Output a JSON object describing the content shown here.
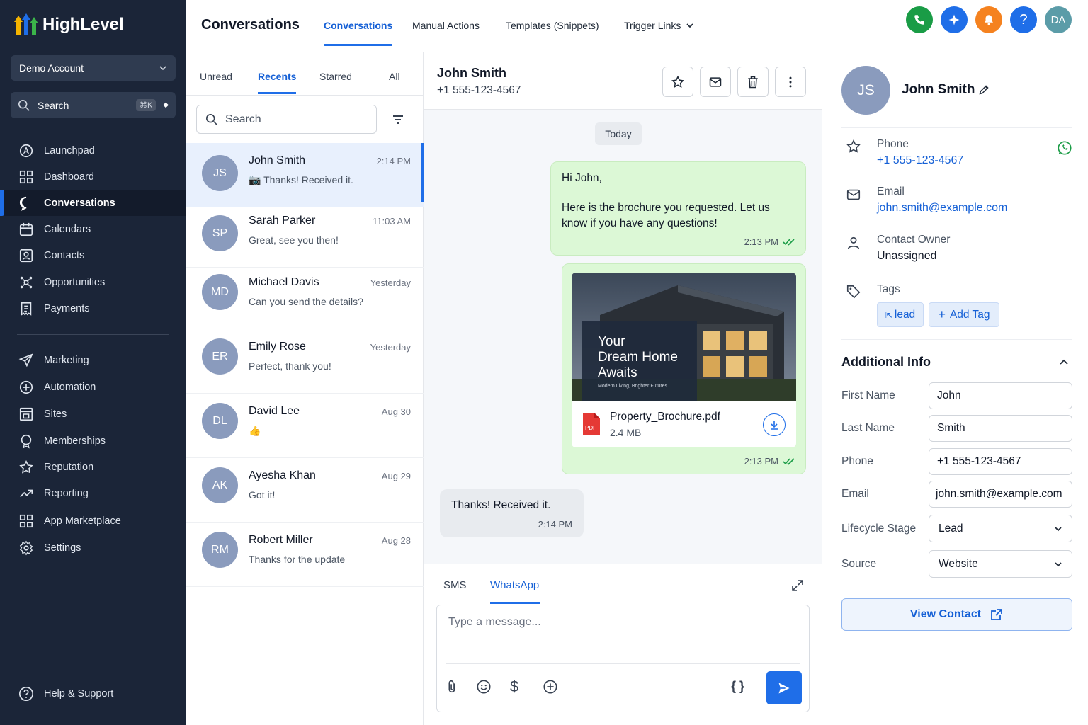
{
  "app": {
    "logo_text": "HighLevel",
    "account": "Demo Account",
    "search_label": "Search",
    "search_shortcut": "⌘K"
  },
  "sidebar": {
    "items": [
      {
        "label": "Launchpad",
        "icon": "rocket-icon"
      },
      {
        "label": "Dashboard",
        "icon": "grid-icon"
      },
      {
        "label": "Conversations",
        "icon": "chat-icon",
        "active": true
      },
      {
        "label": "Calendars",
        "icon": "calendar-icon"
      },
      {
        "label": "Contacts",
        "icon": "contact-card-icon"
      },
      {
        "label": "Opportunities",
        "icon": "network-icon"
      },
      {
        "label": "Payments",
        "icon": "receipt-icon"
      }
    ],
    "items2": [
      {
        "label": "Marketing",
        "icon": "send-icon"
      },
      {
        "label": "Automation",
        "icon": "automation-icon"
      },
      {
        "label": "Sites",
        "icon": "sites-icon"
      },
      {
        "label": "Memberships",
        "icon": "award-icon"
      },
      {
        "label": "Reputation",
        "icon": "star-icon"
      },
      {
        "label": "Reporting",
        "icon": "trend-icon"
      },
      {
        "label": "App Marketplace",
        "icon": "apps-icon"
      },
      {
        "label": "Settings",
        "icon": "gear-icon"
      }
    ],
    "help": "Help & Support"
  },
  "topbar": {
    "title": "Conversations",
    "tabs": [
      "Conversations",
      "Manual Actions",
      "Templates (Snippets)",
      "Trigger Links"
    ],
    "user_initials": "DA",
    "colors": {
      "phone": "#1a9c46",
      "ai": "#1f6ee8",
      "bell": "#f5821f",
      "help": "#1f6ee8",
      "user": "#5b9ca8"
    }
  },
  "list": {
    "filters": [
      "Unread",
      "Recents",
      "Starred",
      "All"
    ],
    "search_placeholder": "Search",
    "conversations": [
      {
        "initials": "JS",
        "name": "John Smith",
        "time": "2:14 PM",
        "preview": "📷 Thanks! Received it."
      },
      {
        "initials": "SP",
        "name": "Sarah Parker",
        "time": "11:03 AM",
        "preview": "Great, see you then!"
      },
      {
        "initials": "MD",
        "name": "Michael Davis",
        "time": "Yesterday",
        "preview": "Can you send the details?"
      },
      {
        "initials": "ER",
        "name": "Emily Rose",
        "time": "Yesterday",
        "preview": "Perfect, thank you!"
      },
      {
        "initials": "DL",
        "name": "David Lee",
        "time": "Aug 30",
        "preview": "👍"
      },
      {
        "initials": "AK",
        "name": "Ayesha Khan",
        "time": "Aug 29",
        "preview": "Got it!"
      },
      {
        "initials": "RM",
        "name": "Robert Miller",
        "time": "Aug 28",
        "preview": "Thanks for the update"
      }
    ]
  },
  "chat": {
    "name": "John Smith",
    "phone": "+1 555-123-4567",
    "day_label": "Today",
    "msg1": {
      "greeting": "Hi John,",
      "body": "Here is the brochure you requested. Let us know if you have any questions!",
      "time": "2:13 PM"
    },
    "attachment": {
      "headline1": "Your",
      "headline2": "Dream Home",
      "headline3": "Awaits",
      "tagline": "Modern Living, Brighter Futures.",
      "filename": "Property_Brochure.pdf",
      "size": "2.4 MB",
      "time": "2:13 PM"
    },
    "reply": {
      "text": "Thanks! Received it.",
      "time": "2:14 PM"
    },
    "compose_tabs": [
      "SMS",
      "WhatsApp"
    ],
    "compose_placeholder": "Type a message..."
  },
  "contact": {
    "initials": "JS",
    "name": "John Smith",
    "phone_label": "Phone",
    "phone": "+1 555-123-4567",
    "email_label": "Email",
    "email": "john.smith@example.com",
    "owner_label": "Contact Owner",
    "owner": "Unassigned",
    "tags_label": "Tags",
    "tag": "lead",
    "add_tag": "Add Tag",
    "additional_title": "Additional Info",
    "fields": [
      {
        "label": "First Name",
        "value": "John"
      },
      {
        "label": "Last Name",
        "value": "Smith"
      },
      {
        "label": "Phone",
        "value": "+1 555-123-4567"
      },
      {
        "label": "Email",
        "value": "john.smith@example.com"
      },
      {
        "label": "Lifecycle Stage",
        "value": "Lead"
      },
      {
        "label": "Source",
        "value": "Website"
      }
    ],
    "view_contact": "View Contact"
  }
}
